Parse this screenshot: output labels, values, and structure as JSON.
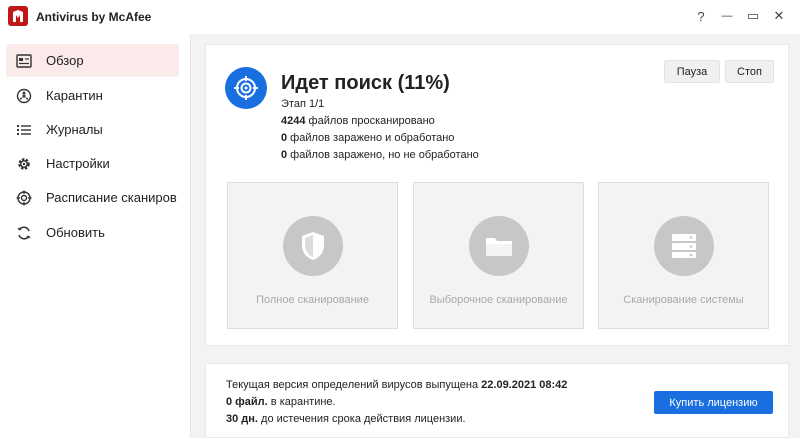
{
  "window": {
    "title": "Antivirus by McAfee",
    "help_glyph": "?",
    "minimize_glyph": "—",
    "maximize_glyph": "▭",
    "close_glyph": "✕"
  },
  "sidebar": {
    "items": [
      {
        "label": "Обзор",
        "icon": "overview-icon"
      },
      {
        "label": "Карантин",
        "icon": "quarantine-icon"
      },
      {
        "label": "Журналы",
        "icon": "list-icon"
      },
      {
        "label": "Настройки",
        "icon": "gear-icon"
      },
      {
        "label": "Расписание сканиров",
        "icon": "schedule-icon"
      },
      {
        "label": "Обновить",
        "icon": "refresh-icon"
      }
    ]
  },
  "scan": {
    "title": "Идет поиск (11%)",
    "progress_percent": 11,
    "stage": "Этап 1/1",
    "files_scanned_count": "4244",
    "files_scanned_text": " файлов просканировано",
    "infected_treated_count": "0",
    "infected_treated_text": " файлов заражено и обработано",
    "infected_untreated_count": "0",
    "infected_untreated_text": " файлов заражено, но не обработано",
    "pause_label": "Пауза",
    "stop_label": "Стоп"
  },
  "cards": [
    {
      "label": "Полное сканирование",
      "icon": "shield-icon"
    },
    {
      "label": "Выборочное сканирование",
      "icon": "folder-icon"
    },
    {
      "label": "Сканирование системы",
      "icon": "server-icon"
    }
  ],
  "info": {
    "defs_text": "Текущая версия определений вирусов выпущена ",
    "defs_date": "22.09.2021 08:42",
    "quarantine_count": "0 файл.",
    "quarantine_text": " в карантине.",
    "license_days": "30 дн.",
    "license_text": " до истечения срока действия лицензии.",
    "buy_label": "Купить лицензию"
  },
  "colors": {
    "accent": "#1a6fe0",
    "brand_red": "#c01818",
    "active_nav_bg": "#fbeaea"
  }
}
